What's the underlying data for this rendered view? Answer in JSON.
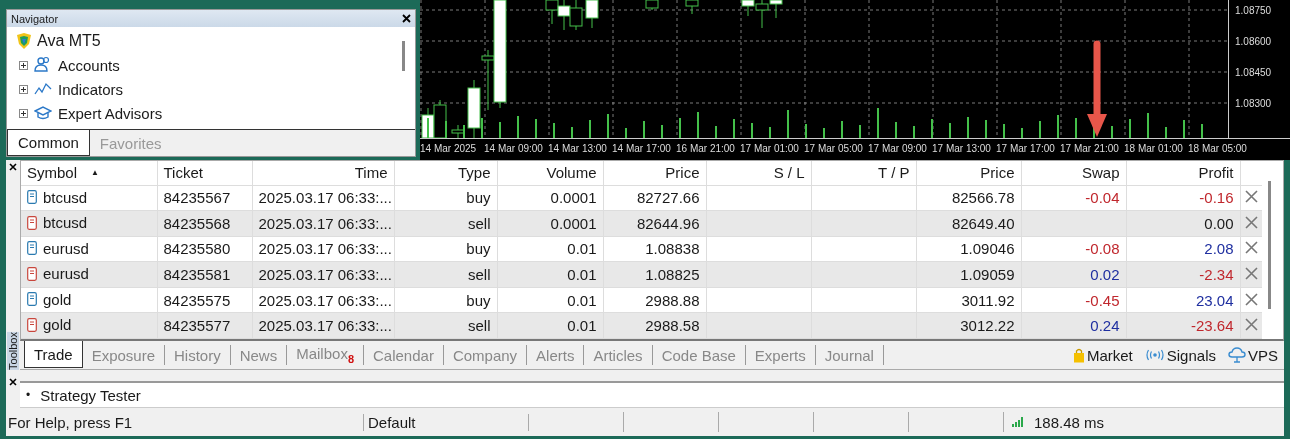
{
  "navigator": {
    "title": "Navigator",
    "root": "Ava MT5",
    "items": [
      {
        "label": "Accounts",
        "kind": "accounts",
        "expanded": false
      },
      {
        "label": "Indicators",
        "kind": "indicators",
        "expanded": false
      },
      {
        "label": "Expert Advisors",
        "kind": "experts",
        "expanded": false
      }
    ],
    "tabs": [
      {
        "label": "Common",
        "selected": true
      },
      {
        "label": "Favorites",
        "selected": false
      }
    ]
  },
  "chart": {
    "price_labels": [
      "1.08750",
      "1.08600",
      "1.08450",
      "1.08300"
    ],
    "time_labels": [
      "14 Mar 2025",
      "14 Mar 09:00",
      "14 Mar 13:00",
      "14 Mar 17:00",
      "16 Mar 21:00",
      "17 Mar 01:00",
      "17 Mar 05:00",
      "17 Mar 09:00",
      "17 Mar 13:00",
      "17 Mar 17:00",
      "17 Mar 21:00",
      "18 Mar 01:00",
      "18 Mar 05:00"
    ]
  },
  "table": {
    "columns": [
      {
        "label": "Symbol",
        "sort_mark": "▲"
      },
      {
        "label": "Ticket"
      },
      {
        "label": "Time"
      },
      {
        "label": "Type"
      },
      {
        "label": "Volume"
      },
      {
        "label": "Price"
      },
      {
        "label": "S / L"
      },
      {
        "label": "T / P"
      },
      {
        "label": "Price"
      },
      {
        "label": "Swap"
      },
      {
        "label": "Profit"
      }
    ],
    "rows": [
      {
        "kind": "buy",
        "symbol": "btcusd",
        "ticket": "84235567",
        "time": "2025.03.17 06:33:...",
        "type": "buy",
        "volume": "0.0001",
        "price": "82727.66",
        "current": "82566.78",
        "swap": {
          "text": "-0.04",
          "color": "#c0272d"
        },
        "profit": {
          "text": "-0.16",
          "color": "#c0272d"
        }
      },
      {
        "kind": "sell",
        "symbol": "btcusd",
        "ticket": "84235568",
        "time": "2025.03.17 06:33:...",
        "type": "sell",
        "volume": "0.0001",
        "price": "82644.96",
        "current": "82649.40",
        "profit": {
          "text": "0.00",
          "color": "#1a1a1a"
        }
      },
      {
        "kind": "buy",
        "symbol": "eurusd",
        "ticket": "84235580",
        "time": "2025.03.17 06:33:...",
        "type": "buy",
        "volume": "0.01",
        "price": "1.08838",
        "current": "1.09046",
        "swap": {
          "text": "-0.08",
          "color": "#c0272d"
        },
        "profit": {
          "text": "2.08",
          "color": "#1f2fa0"
        }
      },
      {
        "kind": "sell",
        "symbol": "eurusd",
        "ticket": "84235581",
        "time": "2025.03.17 06:33:...",
        "type": "sell",
        "volume": "0.01",
        "price": "1.08825",
        "current": "1.09059",
        "swap": {
          "text": "0.02",
          "color": "#1f2fa0"
        },
        "profit": {
          "text": "-2.34",
          "color": "#c0272d"
        }
      },
      {
        "kind": "buy",
        "symbol": "gold",
        "ticket": "84235575",
        "time": "2025.03.17 06:33:...",
        "type": "buy",
        "volume": "0.01",
        "price": "2988.88",
        "current": "3011.92",
        "swap": {
          "text": "-0.45",
          "color": "#c0272d"
        },
        "profit": {
          "text": "23.04",
          "color": "#1f2fa0"
        }
      },
      {
        "kind": "sell",
        "symbol": "gold",
        "ticket": "84235577",
        "time": "2025.03.17 06:33:...",
        "type": "sell",
        "volume": "0.01",
        "price": "2988.58",
        "current": "3012.22",
        "swap": {
          "text": "0.24",
          "color": "#1f2fa0"
        },
        "profit": {
          "text": "-23.64",
          "color": "#c0272d"
        }
      }
    ]
  },
  "toolbox": {
    "label": "Toolbox",
    "tabs": [
      {
        "label": "Trade",
        "selected": true
      },
      {
        "label": "Exposure",
        "selected": false
      },
      {
        "label": "History",
        "selected": false
      },
      {
        "label": "News",
        "selected": false
      },
      {
        "label": "Mailbox",
        "badge": "8",
        "selected": false
      },
      {
        "label": "Calendar",
        "selected": false
      },
      {
        "label": "Company",
        "selected": false
      },
      {
        "label": "Alerts",
        "selected": false
      },
      {
        "label": "Articles",
        "selected": false
      },
      {
        "label": "Code Base",
        "selected": false
      },
      {
        "label": "Experts",
        "selected": false
      },
      {
        "label": "Journal",
        "selected": false
      }
    ],
    "links": [
      {
        "label": "Market",
        "kind": "market"
      },
      {
        "label": "Signals",
        "kind": "signals"
      },
      {
        "label": "VPS",
        "kind": "vps"
      }
    ]
  },
  "strategy_tester": {
    "bullet": "•",
    "label": "Strategy Tester"
  },
  "status_bar": {
    "help": "For Help, press F1",
    "profile": "Default",
    "ping": "188.48 ms"
  }
}
